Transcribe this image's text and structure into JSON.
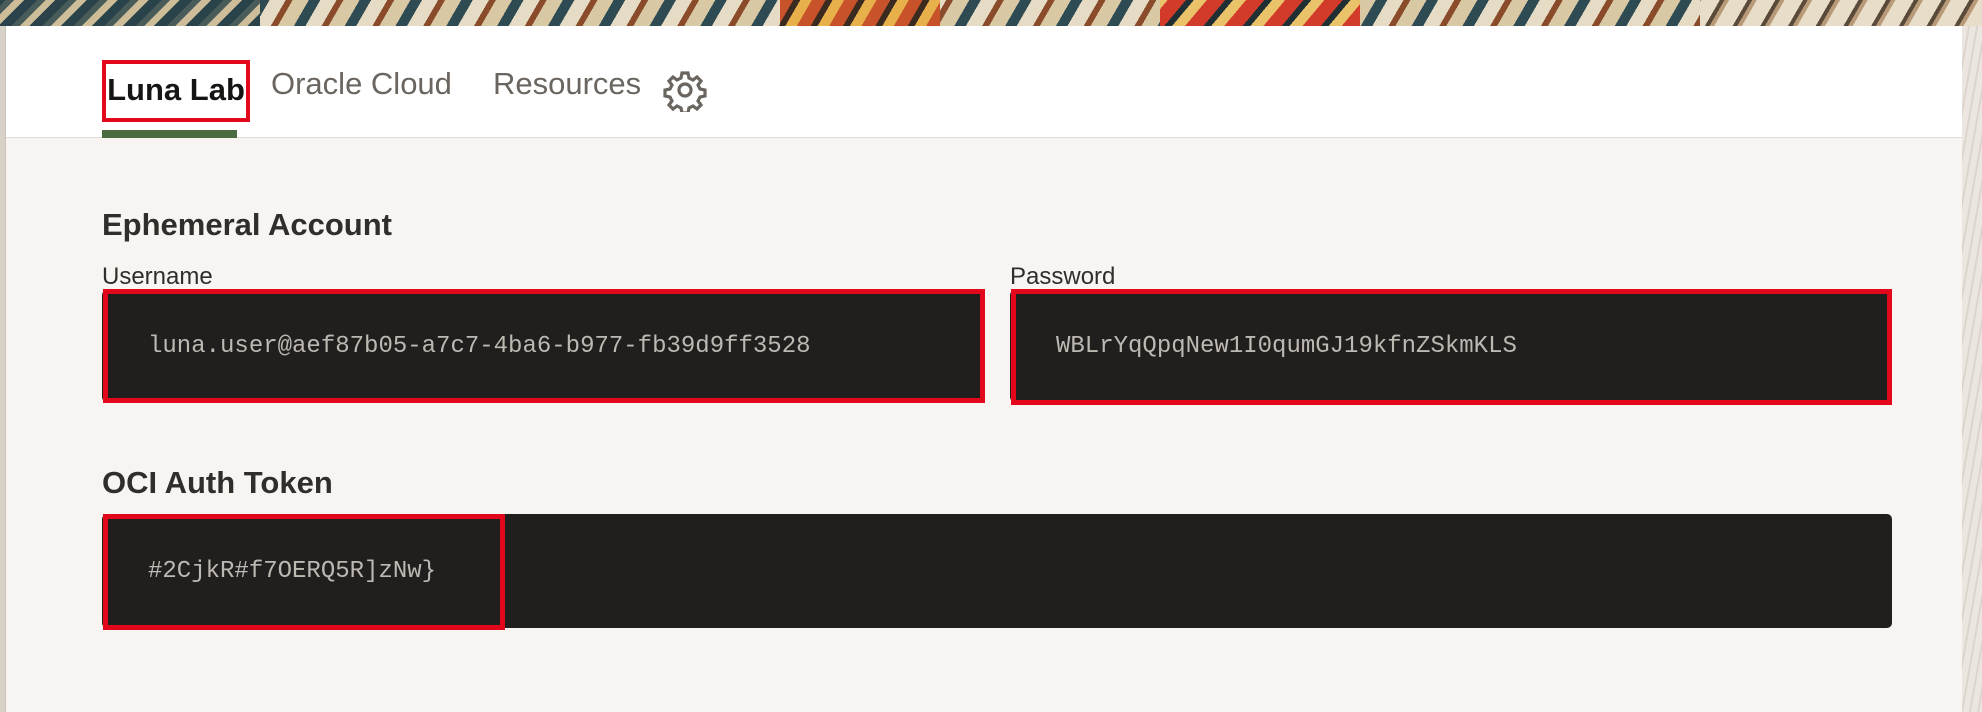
{
  "tabs": [
    {
      "label": "Luna Lab",
      "active": true
    },
    {
      "label": "Oracle Cloud",
      "active": false
    },
    {
      "label": "Resources",
      "active": false
    }
  ],
  "settings_icon": "gear-icon",
  "ephemeral": {
    "title": "Ephemeral Account",
    "username_label": "Username",
    "username_value": "luna.user@aef87b05-a7c7-4ba6-b977-fb39d9ff3528",
    "password_label": "Password",
    "password_value": "WBLrYqQpqNew1I0qumGJ19kfnZSkmKLS"
  },
  "token": {
    "title": "OCI Auth Token",
    "value": "#2CjkR#f7OERQ5R]zNw}"
  },
  "colors": {
    "accent_underline": "#4c6b40",
    "highlight": "#e2071b",
    "code_bg": "#211f1e"
  }
}
